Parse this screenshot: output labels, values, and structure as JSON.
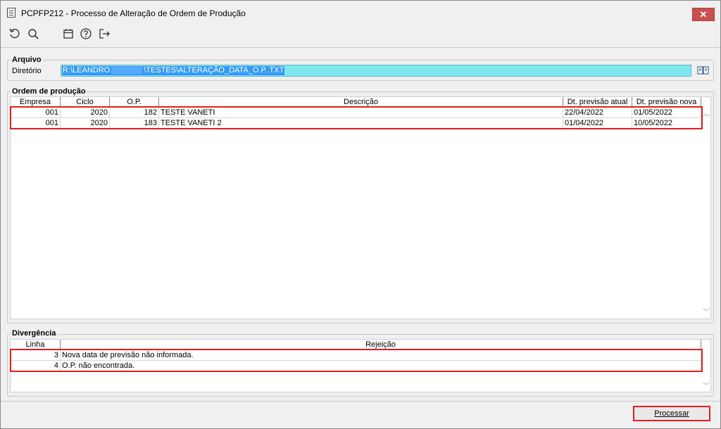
{
  "window": {
    "title": "PCPFP212 - Processo de Alteração de Ordem de Produção",
    "close_glyph": "✕"
  },
  "toolbar": {
    "icons": [
      "refresh-icon",
      "search-icon",
      "calendar-icon",
      "help-icon",
      "exit-icon"
    ]
  },
  "arquivo": {
    "group_title": "Arquivo",
    "diretorio_label": "Diretório",
    "path_prefix": "R:\\LEANDRO",
    "path_suffix": "\\TESTES\\ALTERAÇÃO_DATA_O.P..TXT",
    "field_color": "#7fe8ef"
  },
  "ordem": {
    "group_title": "Ordem de produção",
    "columns": [
      "Empresa",
      "Ciclo",
      "O.P.",
      "Descrição",
      "Dt. previsão atual",
      "Dt. previsão nova"
    ],
    "rows": [
      [
        "001",
        "2020",
        "182",
        "TESTE VANETI",
        "22/04/2022",
        "01/05/2022"
      ],
      [
        "001",
        "2020",
        "183",
        "TESTE VANETI 2",
        "01/04/2022",
        "10/05/2022"
      ]
    ]
  },
  "divergencia": {
    "group_title": "Divergência",
    "columns": [
      "Linha",
      "Rejeição"
    ],
    "rows": [
      [
        "3",
        "Nova data de previsão não informada."
      ],
      [
        "4",
        "O.P. não encontrada."
      ]
    ]
  },
  "actions": {
    "processar_label": "Processar"
  },
  "colors": {
    "highlight": "#e02020",
    "selection": "#3399ff",
    "close": "#c75050"
  }
}
